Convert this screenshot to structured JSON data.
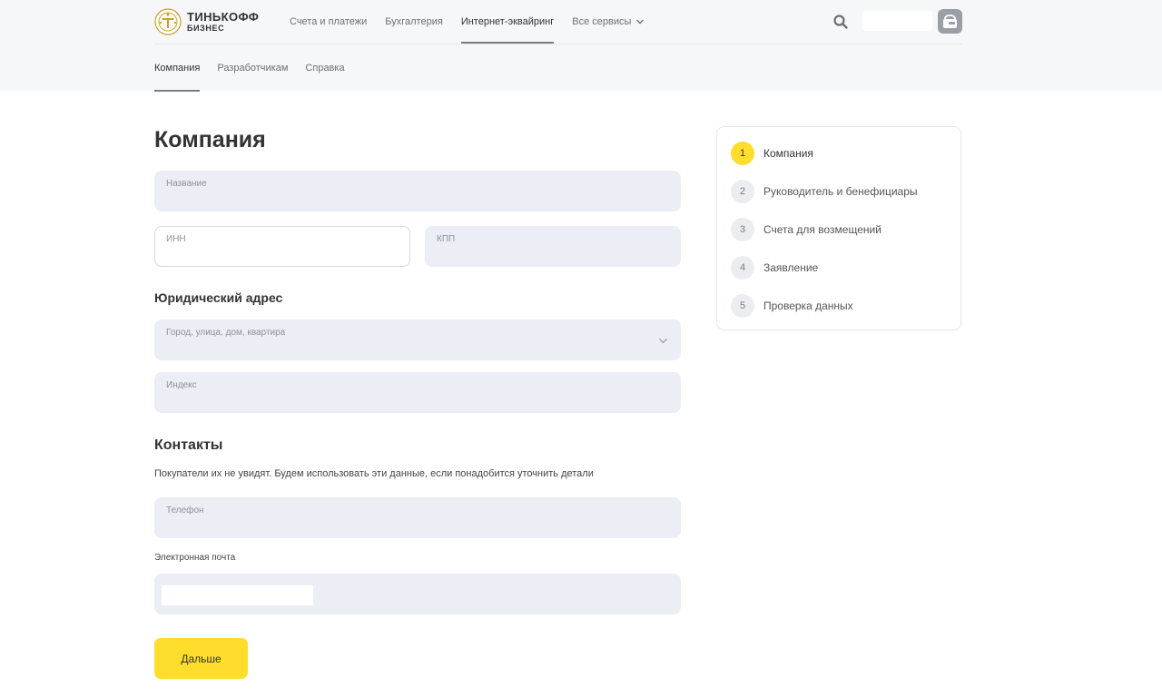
{
  "brand": {
    "title": "ТИНЬКОФФ",
    "subtitle": "БИЗНЕС"
  },
  "topnav": [
    {
      "label": "Счета и платежи",
      "active": false
    },
    {
      "label": "Бухгалтерия",
      "active": false
    },
    {
      "label": "Интернет-эквайринг",
      "active": true
    },
    {
      "label": "Все сервисы",
      "active": false
    }
  ],
  "subnav": [
    {
      "label": "Компания",
      "active": true
    },
    {
      "label": "Разработчикам",
      "active": false
    },
    {
      "label": "Справка",
      "active": false
    }
  ],
  "form": {
    "title": "Компания",
    "fields": {
      "name": {
        "label": "Название"
      },
      "inn": {
        "label": "ИНН"
      },
      "kpp": {
        "label": "КПП"
      },
      "address": {
        "label": "Город, улица, дом, квартира"
      },
      "index": {
        "label": "Индекс"
      },
      "phone": {
        "label": "Телефон"
      }
    },
    "legal_address_title": "Юридический адрес",
    "contacts_title": "Контакты",
    "contacts_desc": "Покупатели их не увидят. Будем использовать эти данные, если понадобится уточнить детали",
    "email_label": "Электронная почта",
    "next_button": "Дальше"
  },
  "steps": [
    {
      "num": "1",
      "label": "Компания",
      "active": true
    },
    {
      "num": "2",
      "label": "Руководитель и бенефициары",
      "active": false
    },
    {
      "num": "3",
      "label": "Счета для возмещений",
      "active": false
    },
    {
      "num": "4",
      "label": "Заявление",
      "active": false
    },
    {
      "num": "5",
      "label": "Проверка данных",
      "active": false
    }
  ],
  "colors": {
    "accent": "#ffdd2d",
    "field_bg": "#ebeef4",
    "header_bg": "#f6f7f8"
  },
  "icons": [
    "logo-emblem",
    "chevron-down-icon",
    "search-icon",
    "account-icon"
  ]
}
